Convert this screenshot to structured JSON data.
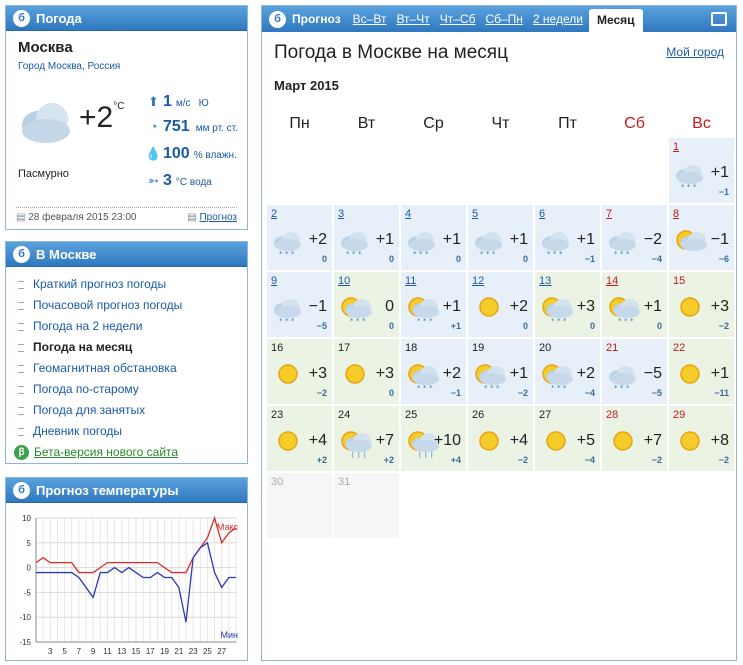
{
  "weather_box": {
    "title": "Погода",
    "city": "Москва",
    "breadcrumb_city": "Город Москва",
    "breadcrumb_sep": ",",
    "breadcrumb_region": "Россия",
    "temp": "+2",
    "temp_unit": "°C",
    "condition": "Пасмурно",
    "wind_speed": "1",
    "wind_unit": "м/с",
    "wind_dir": "Ю",
    "pressure": "751",
    "pressure_unit": "мм рт. ст.",
    "humidity": "100",
    "humidity_unit": "% влажн.",
    "water_temp": "3",
    "water_unit": "°C вода",
    "timestamp": "28 февраля 2015 23:00",
    "forecast_link": "Прогноз",
    "icons": {
      "wind": "wind-arrow-icon",
      "pressure": "pressure-gauge-icon",
      "humidity": "drop-icon",
      "water": "fish-icon",
      "calendar": "calendar-icon",
      "forecast": "document-icon"
    }
  },
  "in_moscow": {
    "title": "В Москве",
    "items": [
      {
        "label": "Краткий прогноз погоды"
      },
      {
        "label": "Почасовой прогноз погоды"
      },
      {
        "label": "Погода на 2 недели"
      },
      {
        "label": "Погода на месяц"
      },
      {
        "label": "Геомагнитная обстановка"
      },
      {
        "label": "Погода по-старому"
      },
      {
        "label": "Погода для занятых"
      },
      {
        "label": "Дневник погоды"
      }
    ],
    "beta_badge": "β",
    "beta_label": "Бета-версия нового сайта"
  },
  "temp_forecast": {
    "title": "Прогноз температуры",
    "max_label": "Макс",
    "min_label": "Мин"
  },
  "chart_data": {
    "type": "line",
    "title": "",
    "xlabel": "",
    "ylabel": "",
    "ylim": [
      -15,
      10
    ],
    "yticks": [
      10,
      5,
      0,
      -5,
      -10,
      -15
    ],
    "xtick_labels": [
      "3",
      "5",
      "7",
      "9",
      "11",
      "13",
      "15",
      "17",
      "19",
      "21",
      "23",
      "25",
      "27"
    ],
    "x": [
      1,
      2,
      3,
      4,
      5,
      6,
      7,
      8,
      9,
      10,
      11,
      12,
      13,
      14,
      15,
      16,
      17,
      18,
      19,
      20,
      21,
      22,
      23,
      24,
      25,
      26,
      27,
      28,
      29
    ],
    "series": [
      {
        "name": "Макс",
        "color": "#d62b2b",
        "values": [
          1,
          2,
          1,
          1,
          1,
          1,
          -1,
          -1,
          -1,
          0,
          1,
          1,
          1,
          1,
          1,
          1,
          1,
          1,
          0,
          -1,
          -1,
          -1,
          2,
          4,
          6,
          10,
          5,
          7,
          8
        ]
      },
      {
        "name": "Мин",
        "color": "#2b3ab0",
        "values": [
          -1,
          -1,
          -1,
          -1,
          -1,
          -1,
          -2,
          -4,
          -6,
          -1,
          -1,
          0,
          -1,
          0,
          -1,
          -2,
          -2,
          -1,
          -2,
          -2,
          -4,
          -11,
          2,
          4,
          5,
          -1,
          -4,
          -2,
          -2
        ]
      }
    ],
    "grid": true
  },
  "tabs": {
    "forecast": "Прогноз",
    "items": [
      {
        "label": "Вс–Вт"
      },
      {
        "label": "Вт–Чт"
      },
      {
        "label": "Чт–Сб"
      },
      {
        "label": "Сб–Пн"
      },
      {
        "label": "2 недели"
      }
    ],
    "active": "Месяц",
    "print_icon": "printer-icon"
  },
  "main": {
    "title": "Погода в Москве на месяц",
    "my_city": "Мой город",
    "month": "Март 2015",
    "weekdays": [
      "Пн",
      "Вт",
      "Ср",
      "Чт",
      "Пт",
      "Сб",
      "Вс"
    ]
  },
  "days": [
    {
      "day": "1",
      "temp": "+1",
      "delta": "−1",
      "icon": "cloud-snow-icon"
    },
    {
      "day": "2",
      "temp": "+2",
      "delta": "0",
      "icon": "cloud-snow-icon"
    },
    {
      "day": "3",
      "temp": "+1",
      "delta": "0",
      "icon": "cloud-sleet-icon"
    },
    {
      "day": "4",
      "temp": "+1",
      "delta": "0",
      "icon": "cloud-snow-icon"
    },
    {
      "day": "5",
      "temp": "+1",
      "delta": "0",
      "icon": "cloud-sleet-icon"
    },
    {
      "day": "6",
      "temp": "+1",
      "delta": "−1",
      "icon": "cloud-snow-icon"
    },
    {
      "day": "7",
      "temp": "−2",
      "delta": "−4",
      "icon": "cloud-snow-icon"
    },
    {
      "day": "8",
      "temp": "−1",
      "delta": "−6",
      "icon": "sun-cloud-icon"
    },
    {
      "day": "9",
      "temp": "−1",
      "delta": "−5",
      "icon": "cloud-snow-icon"
    },
    {
      "day": "10",
      "temp": "0",
      "delta": "0",
      "icon": "sun-cloud-snow-icon"
    },
    {
      "day": "11",
      "temp": "+1",
      "delta": "+1",
      "icon": "sun-cloud-snow-icon"
    },
    {
      "day": "12",
      "temp": "+2",
      "delta": "0",
      "icon": "sun-icon"
    },
    {
      "day": "13",
      "temp": "+3",
      "delta": "0",
      "icon": "sun-cloud-snow-icon"
    },
    {
      "day": "14",
      "temp": "+1",
      "delta": "0",
      "icon": "sun-cloud-snow-icon"
    },
    {
      "day": "15",
      "temp": "+3",
      "delta": "−2",
      "icon": "sun-icon"
    },
    {
      "day": "16",
      "temp": "+3",
      "delta": "−2",
      "icon": "sun-icon"
    },
    {
      "day": "17",
      "temp": "+3",
      "delta": "0",
      "icon": "sun-icon"
    },
    {
      "day": "18",
      "temp": "+2",
      "delta": "−1",
      "icon": "sun-cloud-snow-icon"
    },
    {
      "day": "19",
      "temp": "+1",
      "delta": "−2",
      "icon": "sun-cloud-snow-icon"
    },
    {
      "day": "20",
      "temp": "+2",
      "delta": "−4",
      "icon": "sun-cloud-snow-icon"
    },
    {
      "day": "21",
      "temp": "−5",
      "delta": "−5",
      "icon": "cloud-snow-icon"
    },
    {
      "day": "22",
      "temp": "+1",
      "delta": "−11",
      "icon": "sun-icon"
    },
    {
      "day": "23",
      "temp": "+4",
      "delta": "+2",
      "icon": "sun-icon"
    },
    {
      "day": "24",
      "temp": "+7",
      "delta": "+2",
      "icon": "sun-cloud-rain-icon"
    },
    {
      "day": "25",
      "temp": "+10",
      "delta": "+4",
      "icon": "sun-cloud-rain-icon"
    },
    {
      "day": "26",
      "temp": "+4",
      "delta": "−2",
      "icon": "sun-icon"
    },
    {
      "day": "27",
      "temp": "+5",
      "delta": "−4",
      "icon": "sun-icon"
    },
    {
      "day": "28",
      "temp": "+7",
      "delta": "−2",
      "icon": "sun-icon"
    },
    {
      "day": "29",
      "temp": "+8",
      "delta": "−2",
      "icon": "sun-icon"
    },
    {
      "day": "30"
    },
    {
      "day": "31"
    }
  ]
}
